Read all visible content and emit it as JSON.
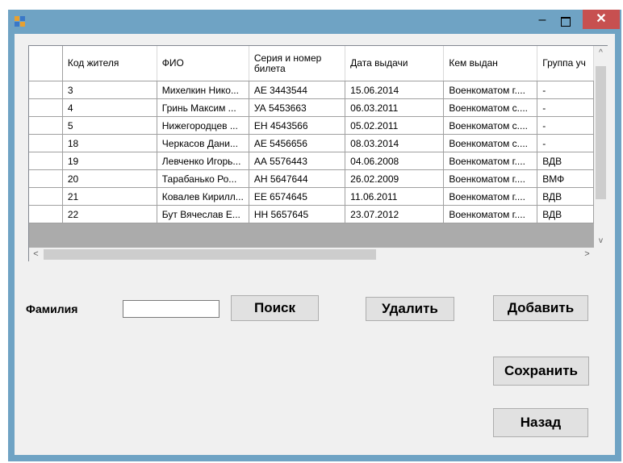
{
  "window": {
    "minimize_glyph": "–",
    "close_glyph": "✕",
    "app_icon": "form-app-icon"
  },
  "grid": {
    "columns": [
      "",
      "Код жителя",
      "ФИО",
      "Серия и номер билета",
      "Дата выдачи",
      "Кем выдан",
      "Группа уч"
    ],
    "rows": [
      [
        "3",
        "Михелкин Нико...",
        "АЕ 3443544",
        "15.06.2014",
        "Военкоматом г....",
        "-"
      ],
      [
        "4",
        "Гринь Максим ...",
        "УА 5453663",
        "06.03.2011",
        "Военкоматом с....",
        "-"
      ],
      [
        "5",
        "Нижегородцев ...",
        "ЕН 4543566",
        "05.02.2011",
        "Военкоматом с....",
        "-"
      ],
      [
        "18",
        "Черкасов Дани...",
        "АЕ 5456656",
        "08.03.2014",
        "Военкоматом с....",
        "-"
      ],
      [
        "19",
        "Левченко Игорь...",
        "АА 5576443",
        "04.06.2008",
        "Военкоматом г....",
        "ВДВ"
      ],
      [
        "20",
        "Тарабанько Ро...",
        "АН 5647644",
        "26.02.2009",
        "Военкоматом г....",
        "ВМФ"
      ],
      [
        "21",
        "Ковалев Кирилл...",
        "ЕЕ 6574645",
        "11.06.2011",
        "Военкоматом г....",
        "ВДВ"
      ],
      [
        "22",
        "Бут Вячеслав Е...",
        "НН 5657645",
        "23.07.2012",
        "Военкоматом г....",
        "ВДВ"
      ]
    ],
    "scroll_up_glyph": "^",
    "scroll_down_glyph": "v",
    "scroll_left_glyph": "<",
    "scroll_right_glyph": ">"
  },
  "form": {
    "surname_label": "Фамилия",
    "surname_value": "",
    "search_label": "Поиск",
    "delete_label": "Удалить",
    "add_label": "Добавить",
    "save_label": "Сохранить",
    "back_label": "Назад"
  },
  "colors": {
    "frame": "#6fa3c4",
    "close_button": "#c75050",
    "client_bg": "#f0f0f0"
  }
}
